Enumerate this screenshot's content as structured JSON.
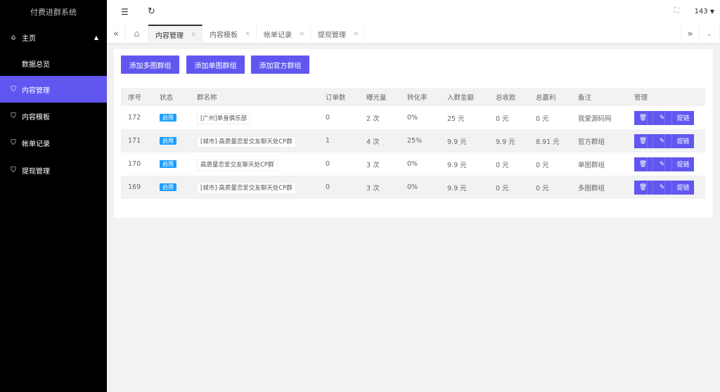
{
  "app": {
    "title": "付费进群系统"
  },
  "sidebar": {
    "items": [
      {
        "label": "主页",
        "icon": "home-icon"
      },
      {
        "label": "数据总览"
      },
      {
        "label": "内容管理",
        "icon": "shield-icon",
        "active": true
      },
      {
        "label": "内容模板",
        "icon": "shield-icon"
      },
      {
        "label": "帐单记录",
        "icon": "shield-icon"
      },
      {
        "label": "提现管理",
        "icon": "shield-icon"
      }
    ]
  },
  "header": {
    "user": "143"
  },
  "tabs": [
    {
      "label": "内容管理",
      "active": true
    },
    {
      "label": "内容模板"
    },
    {
      "label": "帐单记录"
    },
    {
      "label": "提现管理"
    }
  ],
  "toolbar": {
    "add_multi": "添加多图群组",
    "add_single": "添加单图群组",
    "add_official": "添加官方群组"
  },
  "table": {
    "headers": [
      "序号",
      "状态",
      "群名称",
      "订单数",
      "曝光量",
      "转化率",
      "入群金额",
      "总收款",
      "总赢利",
      "备注",
      "管理"
    ],
    "rows": [
      {
        "id": "172",
        "status": "启用",
        "name": "[广州]单身俱乐部",
        "orders": "0",
        "views": "2 次",
        "rate": "0%",
        "price": "25 元",
        "income": "0 元",
        "profit": "0 元",
        "note": "我爱源码网"
      },
      {
        "id": "171",
        "status": "启用",
        "name": "[城市]·高质量恋爱交友聊天处CP群",
        "orders": "1",
        "views": "4 次",
        "rate": "25%",
        "price": "9.9 元",
        "income": "9.9 元",
        "profit": "8.91 元",
        "note": "官方群组"
      },
      {
        "id": "170",
        "status": "启用",
        "name": "高质量恋爱交友聊天处CP群",
        "orders": "0",
        "views": "3 次",
        "rate": "0%",
        "price": "9.9 元",
        "income": "0 元",
        "profit": "0 元",
        "note": "单图群组"
      },
      {
        "id": "169",
        "status": "启用",
        "name": "[城市]·高质量恋爱交友聊天处CP群",
        "orders": "0",
        "views": "3 次",
        "rate": "0%",
        "price": "9.9 元",
        "income": "0 元",
        "profit": "0 元",
        "note": "多图群组"
      }
    ],
    "link_label": "提链"
  },
  "colors": {
    "accent": "#6157f0",
    "badge": "#1e9fff",
    "sidebar": "#000000"
  }
}
